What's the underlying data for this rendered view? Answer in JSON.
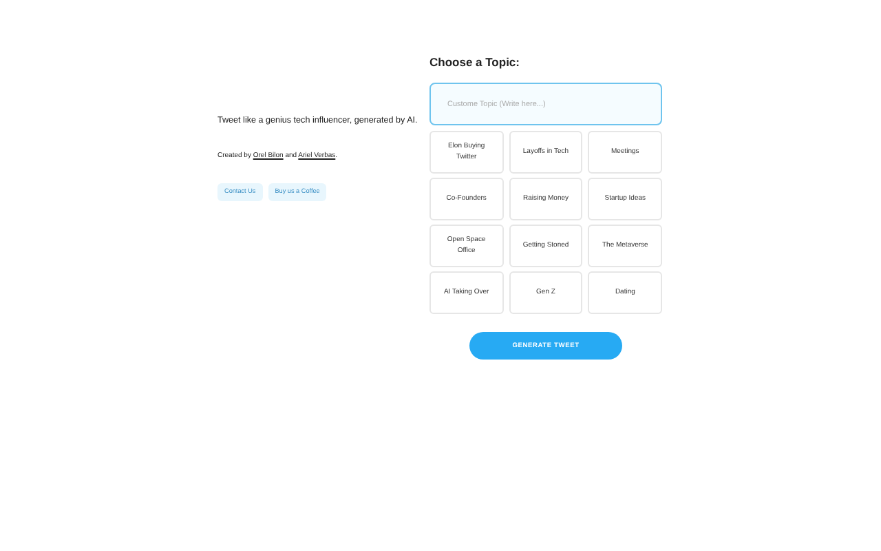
{
  "intro": {
    "tagline": "Tweet like a genius tech influencer, generated by AI.",
    "credits": [
      {
        "kind": "text",
        "text": "Created by"
      },
      {
        "kind": "link",
        "text": "Orel Bilon"
      },
      {
        "kind": "text",
        "text": "and"
      },
      {
        "kind": "link",
        "text": "Ariel Verbas"
      },
      {
        "kind": "text",
        "text": "."
      }
    ],
    "buttons": [
      "Contact Us",
      "Buy us a Coffee"
    ]
  },
  "topic": {
    "heading": "Choose a Topic:",
    "custom": {
      "placeholder": "Custome Topic (Write here...)"
    },
    "options": [
      "Elon Buying Twitter",
      "Layoffs in Tech",
      "Meetings",
      "Co-Founders",
      "Raising Money",
      "Startup Ideas",
      "Open Space Office",
      "Getting Stoned",
      "The Metaverse",
      "AI Taking Over",
      "Gen Z",
      "Dating"
    ],
    "generate": "GENERATE TWEET"
  }
}
